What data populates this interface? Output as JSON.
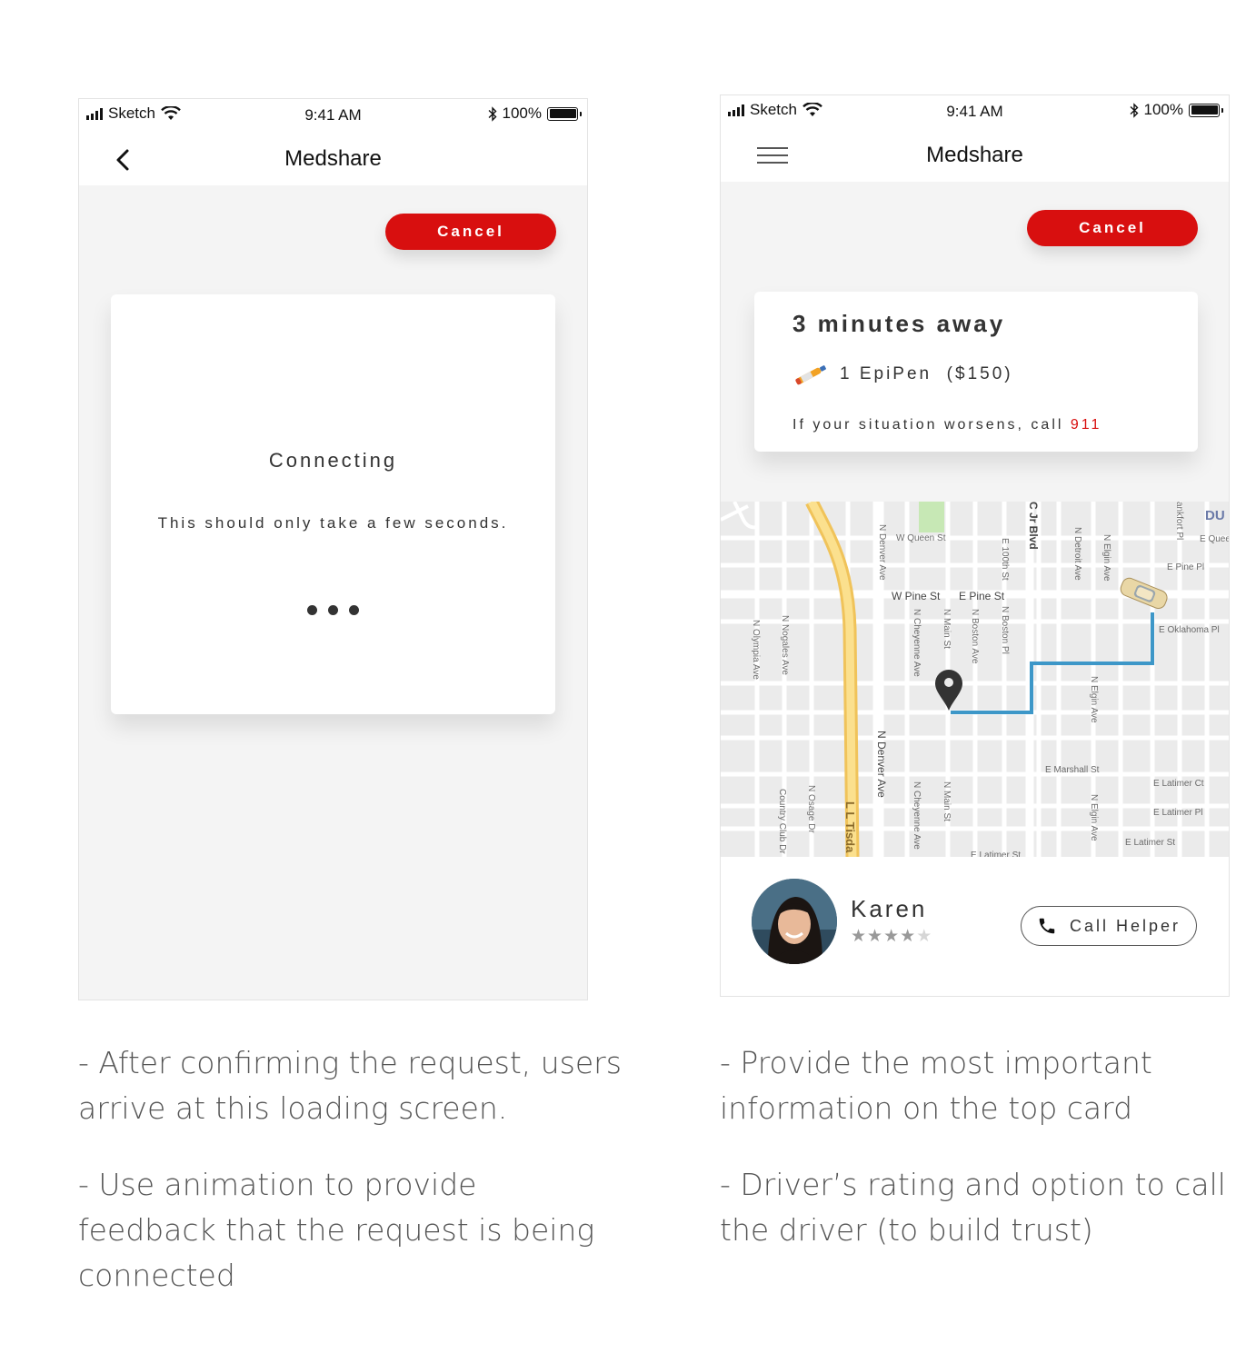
{
  "status_bar": {
    "carrier": "Sketch",
    "time": "9:41 AM",
    "battery": "100%"
  },
  "screen1": {
    "app_title": "Medshare",
    "cancel_label": "Cancel",
    "loading_title": "Connecting",
    "loading_message": "This should only take a few seconds."
  },
  "screen2": {
    "app_title": "Medshare",
    "cancel_label": "Cancel",
    "eta": "3 minutes away",
    "order": "1 EpiPen  ($150)",
    "warning_prefix": "If your situation worsens, call ",
    "warning_number": "911",
    "map": {
      "street_labels": [
        "W Queen St",
        "W Pine St",
        "E Pine St",
        "E Pine Pl",
        "E Oklahoma Pl",
        "E Marshall St",
        "E Latimer Ct",
        "E Latimer Pl",
        "E Latimer St",
        "E Latimer St",
        "N Denver Ave",
        "N Denver Ave",
        "N Olympia Ave",
        "N Nogales Ave",
        "N Cheyenne Ave",
        "N Cheyenne Ave",
        "N Main St",
        "N Main St",
        "N Boston Ave",
        "N Boston Pl",
        "E 100th St",
        "N Detroit Ave",
        "N Elgin Ave",
        "N Elgin Ave",
        "N Elgin Ave",
        "N Osage Dr",
        "Country Club Dr",
        "L L Tisda",
        "C Jr Blvd",
        "E Queen",
        "DU"
      ],
      "route_color": "#3d97c8"
    },
    "helper_name": "Karen",
    "rating": 4,
    "rating_max": 5,
    "call_label": "Call Helper"
  },
  "captions": {
    "left": [
      "- After confirming the request, users arrive at this loading screen.",
      "- Use animation to provide feedback that the request is being connected"
    ],
    "right": [
      "- Provide the most important information on the top card",
      "- Driver’s rating and option to call the driver (to build trust)"
    ]
  },
  "colors": {
    "accent": "#d80f0f",
    "route": "#3d97c8",
    "background": "#f4f4f4"
  },
  "icons": [
    "signal-icon",
    "wifi-icon",
    "bluetooth-icon",
    "battery-icon",
    "back-chevron-icon",
    "hamburger-menu-icon",
    "epipen-icon",
    "location-pin-icon",
    "car-icon",
    "phone-icon",
    "star-icon"
  ]
}
